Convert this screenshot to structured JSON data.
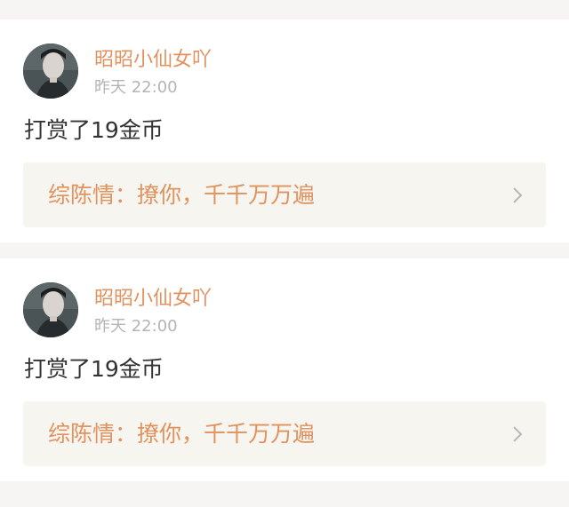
{
  "posts": [
    {
      "username": "昭昭小仙女吖",
      "time": "昨天 22:00",
      "message": "打赏了19金币",
      "link_title": "综陈情：撩你，千千万万遍"
    },
    {
      "username": "昭昭小仙女吖",
      "time": "昨天 22:00",
      "message": "打赏了19金币",
      "link_title": "综陈情：撩你，千千万万遍"
    }
  ],
  "icons": {
    "avatar": "user-avatar-portrait",
    "chevron": "chevron-right-icon"
  },
  "colors": {
    "accent": "#e0925f",
    "muted": "#b4b4b4",
    "text": "#333333",
    "link_bg": "#f7f5ef",
    "page_bg": "#f7f4f4"
  }
}
